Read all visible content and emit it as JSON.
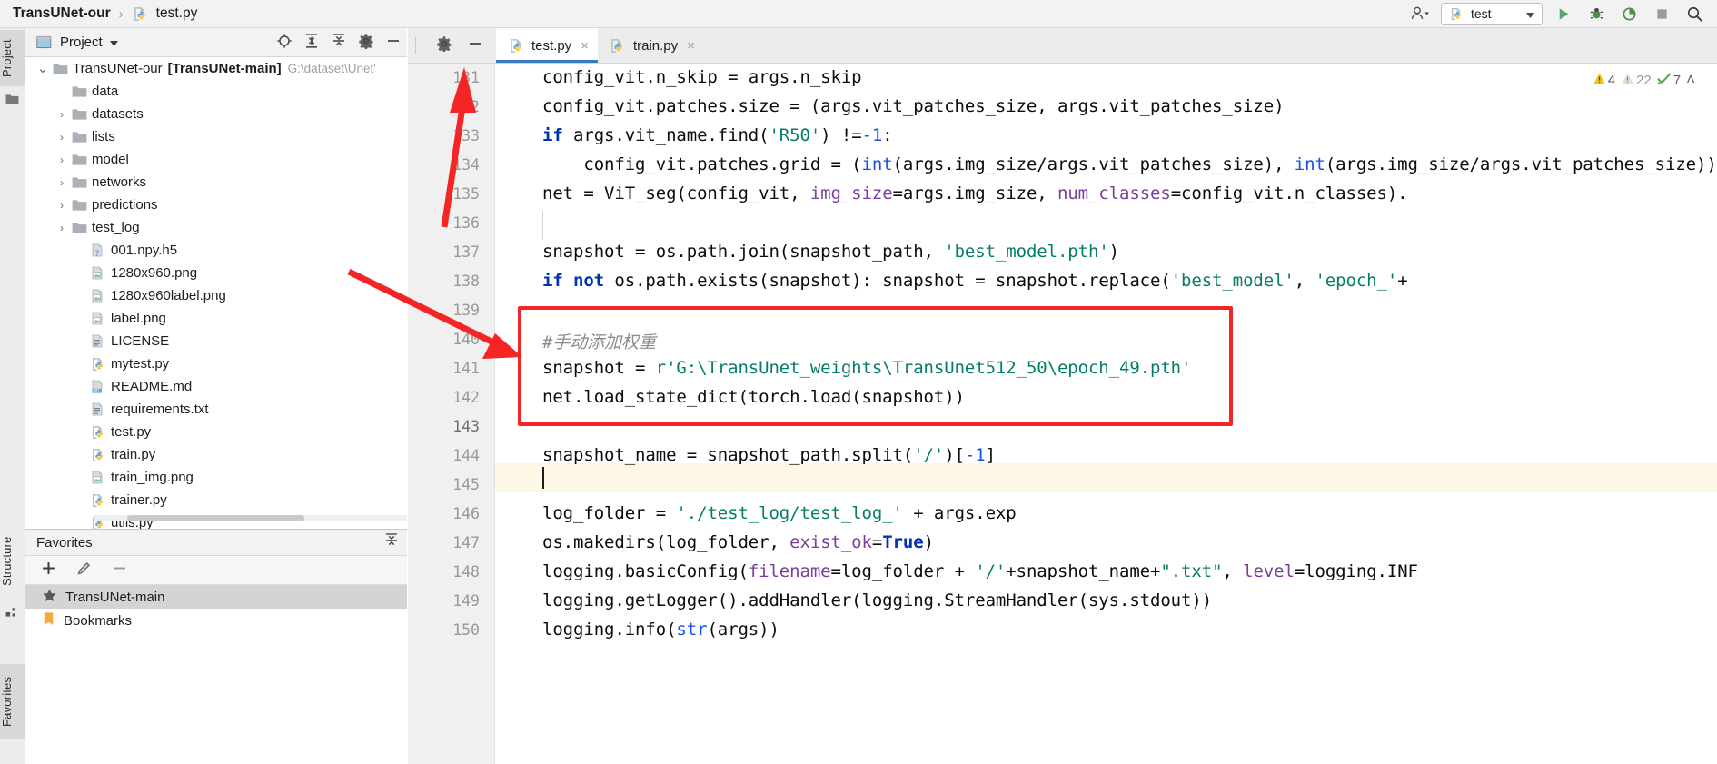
{
  "window": {
    "breadcrumb_root": "TransUNet-our",
    "breadcrumb_sep": "›",
    "breadcrumb_file": "test.py",
    "run_config": "test",
    "accent_blue": "#3a78c8",
    "annotation_red": "#f42525"
  },
  "toolbar": {
    "user_icon": "user-icon",
    "run_icon": "run-icon",
    "debug_icon": "debug-icon",
    "coverage_icon": "coverage-icon",
    "stop_icon": "stop-icon",
    "search_icon": "search-icon",
    "caret_icon": "chevron-down-icon"
  },
  "left_strip": {
    "tabs": [
      {
        "label": "Project",
        "selected": true
      },
      {
        "label": "Structure",
        "selected": false
      },
      {
        "label": "Favorites",
        "selected": false
      }
    ]
  },
  "project_panel": {
    "title": "Project",
    "caret": "▾",
    "actions": [
      "locate-icon",
      "expand-all-icon",
      "collapse-all-icon",
      "settings-icon",
      "hide-icon"
    ],
    "tree": [
      {
        "indent": 0,
        "twist": "⌄",
        "icon": "folder-icon",
        "label": "TransUNet-our",
        "bold_suffix": "[TransUNet-main]",
        "path": "G:\\dataset\\Unet'"
      },
      {
        "indent": 1,
        "twist": "",
        "icon": "folder-icon",
        "label": "data"
      },
      {
        "indent": 1,
        "twist": "›",
        "icon": "folder-icon",
        "label": "datasets"
      },
      {
        "indent": 1,
        "twist": "›",
        "icon": "folder-icon",
        "label": "lists"
      },
      {
        "indent": 1,
        "twist": "›",
        "icon": "folder-icon",
        "label": "model"
      },
      {
        "indent": 1,
        "twist": "›",
        "icon": "folder-icon",
        "label": "networks"
      },
      {
        "indent": 1,
        "twist": "›",
        "icon": "folder-icon",
        "label": "predictions"
      },
      {
        "indent": 1,
        "twist": "›",
        "icon": "folder-icon",
        "label": "test_log"
      },
      {
        "indent": 2,
        "twist": "",
        "icon": "unknown-file-icon",
        "label": "001.npy.h5"
      },
      {
        "indent": 2,
        "twist": "",
        "icon": "image-file-icon",
        "label": "1280x960.png"
      },
      {
        "indent": 2,
        "twist": "",
        "icon": "image-file-icon",
        "label": "1280x960label.png"
      },
      {
        "indent": 2,
        "twist": "",
        "icon": "image-file-icon",
        "label": "label.png"
      },
      {
        "indent": 2,
        "twist": "",
        "icon": "text-file-icon",
        "label": "LICENSE"
      },
      {
        "indent": 2,
        "twist": "",
        "icon": "python-file-icon",
        "label": "mytest.py"
      },
      {
        "indent": 2,
        "twist": "",
        "icon": "markdown-file-icon",
        "label": "README.md"
      },
      {
        "indent": 2,
        "twist": "",
        "icon": "text-file-icon",
        "label": "requirements.txt"
      },
      {
        "indent": 2,
        "twist": "",
        "icon": "python-file-icon",
        "label": "test.py"
      },
      {
        "indent": 2,
        "twist": "",
        "icon": "python-file-icon",
        "label": "train.py"
      },
      {
        "indent": 2,
        "twist": "",
        "icon": "image-file-icon",
        "label": "train_img.png"
      },
      {
        "indent": 2,
        "twist": "",
        "icon": "python-file-icon",
        "label": "trainer.py"
      },
      {
        "indent": 2,
        "twist": "",
        "icon": "python-file-icon",
        "label": "utils.py"
      }
    ]
  },
  "favorites_panel": {
    "title": "Favorites",
    "collapse_icon": "collapse-all-icon",
    "toolbar": [
      "add-icon",
      "edit-icon",
      "remove-icon"
    ],
    "items": [
      {
        "icon": "star-icon",
        "label": "TransUNet-main",
        "selected": true
      },
      {
        "icon": "bookmark-icon",
        "label": "Bookmarks",
        "selected": false
      }
    ]
  },
  "editor": {
    "tools": [
      "settings-icon",
      "hide-icon"
    ],
    "tabs": [
      {
        "label": "test.py",
        "icon": "python-file-icon",
        "active": true,
        "close": "×"
      },
      {
        "label": "train.py",
        "icon": "python-file-icon",
        "active": false,
        "close": "×"
      }
    ],
    "inspections": {
      "warning_count": "4",
      "weak_warning_count": "22",
      "ok_count": "7",
      "collapse_caret": "˄"
    },
    "line_numbers": [
      "131",
      "132",
      "133",
      "134",
      "135",
      "136",
      "137",
      "138",
      "139",
      "140",
      "141",
      "142",
      "143",
      "144",
      "145",
      "146",
      "147",
      "148",
      "149",
      "150"
    ],
    "current_line": "143",
    "lines": [
      {
        "n": "131",
        "text": "config_vit.n_skip = args.n_skip"
      },
      {
        "n": "132",
        "text": "config_vit.patches.size = (args.vit_patches_size, args.vit_patches_size)"
      },
      {
        "n": "133",
        "text": "if args.vit_name.find('R50') !=-1:"
      },
      {
        "n": "134",
        "text": "    config_vit.patches.grid = (int(args.img_size/args.vit_patches_size), int(args.img_size/args.vit_patches_size))"
      },
      {
        "n": "135",
        "text": "net = ViT_seg(config_vit, img_size=args.img_size, num_classes=config_vit.n_classes)."
      },
      {
        "n": "136",
        "text": ""
      },
      {
        "n": "137",
        "text": "snapshot = os.path.join(snapshot_path, 'best_model.pth')"
      },
      {
        "n": "138",
        "text": "if not os.path.exists(snapshot): snapshot = snapshot.replace('best_model', 'epoch_'+"
      },
      {
        "n": "139",
        "text": ""
      },
      {
        "n": "140",
        "text": "#手动添加权重"
      },
      {
        "n": "141",
        "text": "snapshot = r'G:\\TransUnet_weights\\TransUnet512_50\\epoch_49.pth'"
      },
      {
        "n": "142",
        "text": "net.load_state_dict(torch.load(snapshot))"
      },
      {
        "n": "143",
        "text": ""
      },
      {
        "n": "144",
        "text": "snapshot_name = snapshot_path.split('/')[-1]"
      },
      {
        "n": "145",
        "text": ""
      },
      {
        "n": "146",
        "text": "log_folder = './test_log/test_log_' + args.exp"
      },
      {
        "n": "147",
        "text": "os.makedirs(log_folder, exist_ok=True)"
      },
      {
        "n": "148",
        "text": "logging.basicConfig(filename=log_folder + '/'+snapshot_name+\".txt\", level=logging.INFO,"
      },
      {
        "n": "149",
        "text": "logging.getLogger().addHandler(logging.StreamHandler(sys.stdout))"
      },
      {
        "n": "150",
        "text": "logging.info(str(args))"
      }
    ]
  },
  "annotations": {
    "arrow_top_label": "arrow-to-tab",
    "arrow_box_label": "arrow-to-added-code",
    "box_label": "highlighted-added-code-block"
  }
}
